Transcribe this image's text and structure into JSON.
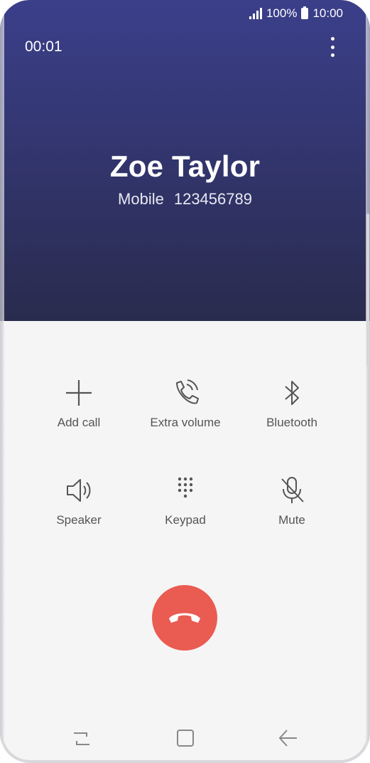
{
  "status_bar": {
    "battery": "100%",
    "time": "10:00"
  },
  "call": {
    "duration": "00:01",
    "contact_name": "Zoe Taylor",
    "number_type": "Mobile",
    "number": "123456789"
  },
  "actions": [
    {
      "label": "Add call",
      "icon": "plus-icon"
    },
    {
      "label": "Extra volume",
      "icon": "phone-volume-icon"
    },
    {
      "label": "Bluetooth",
      "icon": "bluetooth-icon"
    },
    {
      "label": "Speaker",
      "icon": "speaker-icon"
    },
    {
      "label": "Keypad",
      "icon": "keypad-icon"
    },
    {
      "label": "Mute",
      "icon": "microphone-off-icon"
    }
  ],
  "colors": {
    "header_top": "#3b3f8a",
    "header_bottom": "#292b4e",
    "end_call": "#ea5b52",
    "background": "#f5f5f5",
    "label": "#555555"
  },
  "nav": {
    "icons": [
      "recent-apps-icon",
      "home-icon",
      "back-icon"
    ]
  }
}
